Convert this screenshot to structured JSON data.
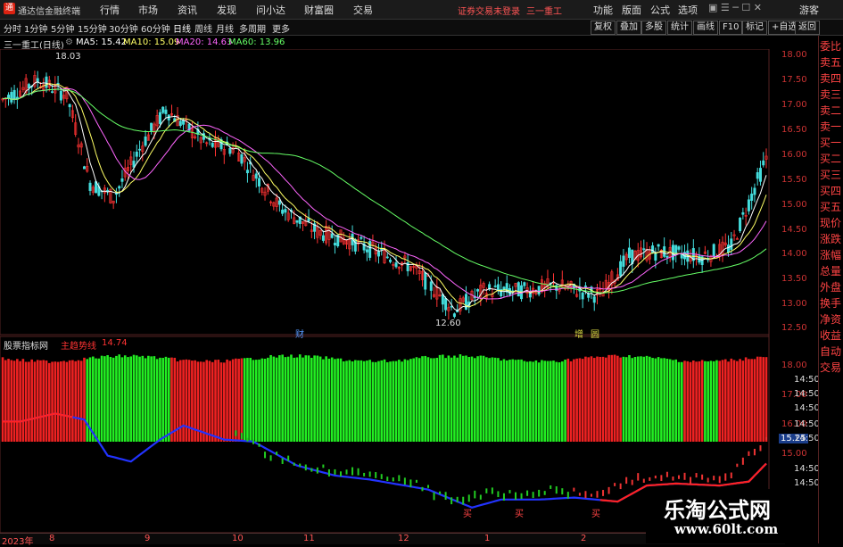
{
  "menubar": {
    "app_title": "通达信金融终端",
    "items": [
      "行情",
      "市场",
      "资讯",
      "发现",
      "问小达",
      "财富圈",
      "交易"
    ],
    "login_status": "证券交易未登录",
    "stock_title": "三一重工",
    "right_items": [
      "功能",
      "版面",
      "公式",
      "选项"
    ],
    "guest": "游客"
  },
  "periods": [
    "分时",
    "1分钟",
    "5分钟",
    "15分钟",
    "30分钟",
    "60分钟",
    "日线",
    "周线",
    "月线",
    "多周期",
    "更多"
  ],
  "active_period": "日线",
  "toolbar_right": [
    "复权",
    "叠加",
    "多股",
    "统计",
    "画线",
    "F10",
    "标记",
    "+自选",
    "返回"
  ],
  "main_chart": {
    "stock": "三一重工(日线)",
    "ma": [
      {
        "label": "MA5: 15.42",
        "color": "#ffffff"
      },
      {
        "label": "MA10: 15.09",
        "color": "#ffff66"
      },
      {
        "label": "MA20: 14.63",
        "color": "#ff66ff"
      },
      {
        "label": "MA60: 13.96",
        "color": "#66ff66"
      }
    ],
    "high_marker": "18.03",
    "low_marker": "12.60",
    "event_markers": [
      "财",
      "增",
      "圆"
    ],
    "y_ticks": [
      "18.00",
      "17.50",
      "17.00",
      "16.50",
      "16.00",
      "15.50",
      "15.00",
      "14.50",
      "14.00",
      "13.50",
      "13.00",
      "12.50"
    ]
  },
  "sub_chart": {
    "title": "股票指标网",
    "indicator_label": "主趋势线",
    "indicator_value": "14.74",
    "y_ticks_left": [
      "18.00",
      "17.00",
      "16.00",
      "15.25",
      "15.00"
    ],
    "y_ticks_right": [
      "14:50",
      "14:50",
      "14:50",
      "14:50",
      "14:50",
      "14:50",
      "14:50",
      "14:50"
    ],
    "buy_label": "买"
  },
  "side_panel": [
    "委比",
    "卖五",
    "卖四",
    "卖三",
    "卖二",
    "卖一",
    "买一",
    "买二",
    "买三",
    "买四",
    "买五",
    "现价",
    "涨跌",
    "涨幅",
    "总量",
    "外盘",
    "换手",
    "净资",
    "收益",
    "自动",
    "交易"
  ],
  "dates": [
    {
      "label": "2023年",
      "x": 2
    },
    {
      "label": "8",
      "x": 55
    },
    {
      "label": "9",
      "x": 162
    },
    {
      "label": "10",
      "x": 260
    },
    {
      "label": "11",
      "x": 340
    },
    {
      "label": "12",
      "x": 446
    },
    {
      "label": "1",
      "x": 543
    },
    {
      "label": "2",
      "x": 651
    }
  ],
  "watermark": {
    "name": "乐淘公式网",
    "url": "www.60lt.com"
  }
}
